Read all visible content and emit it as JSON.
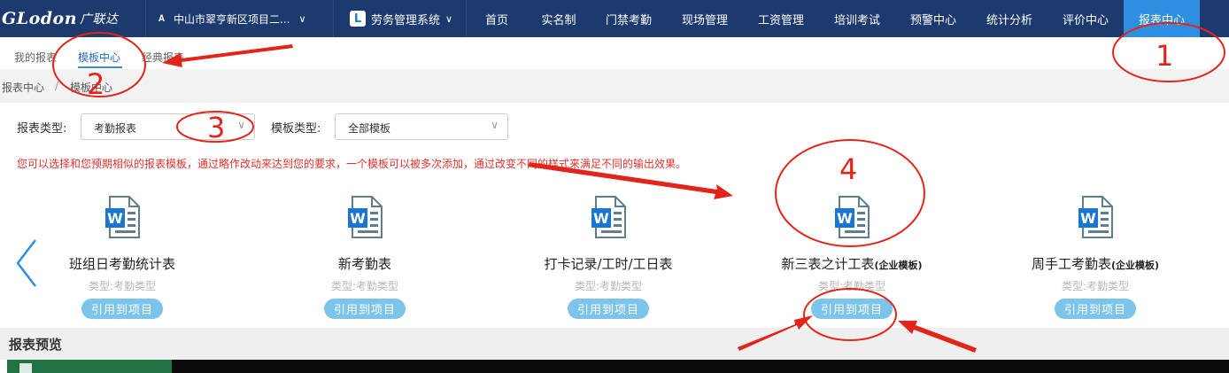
{
  "header": {
    "logo_text": "GLodon",
    "logo_cn": "广联达",
    "project_name": "中山市翠亨新区项目二...",
    "system_name": "劳务管理系统",
    "system_logo_letter": "L",
    "nav": [
      "首页",
      "实名制",
      "门禁考勤",
      "现场管理",
      "工资管理",
      "培训考试",
      "预警中心",
      "统计分析",
      "评价中心",
      "报表中心"
    ],
    "active_nav": "报表中心"
  },
  "subtabs": [
    "我的报表",
    "模板中心",
    "经典报表"
  ],
  "active_subtab": "模板中心",
  "breadcrumb": [
    "报表中心",
    "模板中心"
  ],
  "filters": {
    "report_type_label": "报表类型:",
    "report_type_value": "考勤报表",
    "template_type_label": "模板类型:",
    "template_type_value": "全部模板"
  },
  "notice": "您可以选择和您预期相似的报表模板，通过略作改动来达到您的要求，一个模板可以被多次添加，通过改变不同的样式来满足不同的输出效果。",
  "cards": [
    {
      "title": "班组日考勤统计表",
      "tag": "",
      "type": "类型:考勤类型",
      "button": "引用到项目"
    },
    {
      "title": "新考勤表",
      "tag": "",
      "type": "类型:考勤类型",
      "button": "引用到项目"
    },
    {
      "title": "打卡记录/工时/工日表",
      "tag": "",
      "type": "类型:考勤类型",
      "button": "引用到项目"
    },
    {
      "title": "新三表之计工表",
      "tag": "(企业模板)",
      "type": "类型:考勤类型",
      "button": "引用到项目"
    },
    {
      "title": "周手工考勤表",
      "tag": "(企业模板)",
      "type": "类型:考勤类型",
      "button": "引用到项目"
    }
  ],
  "preview_title": "报表预览",
  "annotations": [
    "1",
    "2",
    "3",
    "4"
  ],
  "colors": {
    "header_bg": "#1d3a6e",
    "active_nav": "#2e8ee0",
    "notice": "#e3322b",
    "button": "#7cc4ea",
    "annotation": "#e3241b"
  }
}
